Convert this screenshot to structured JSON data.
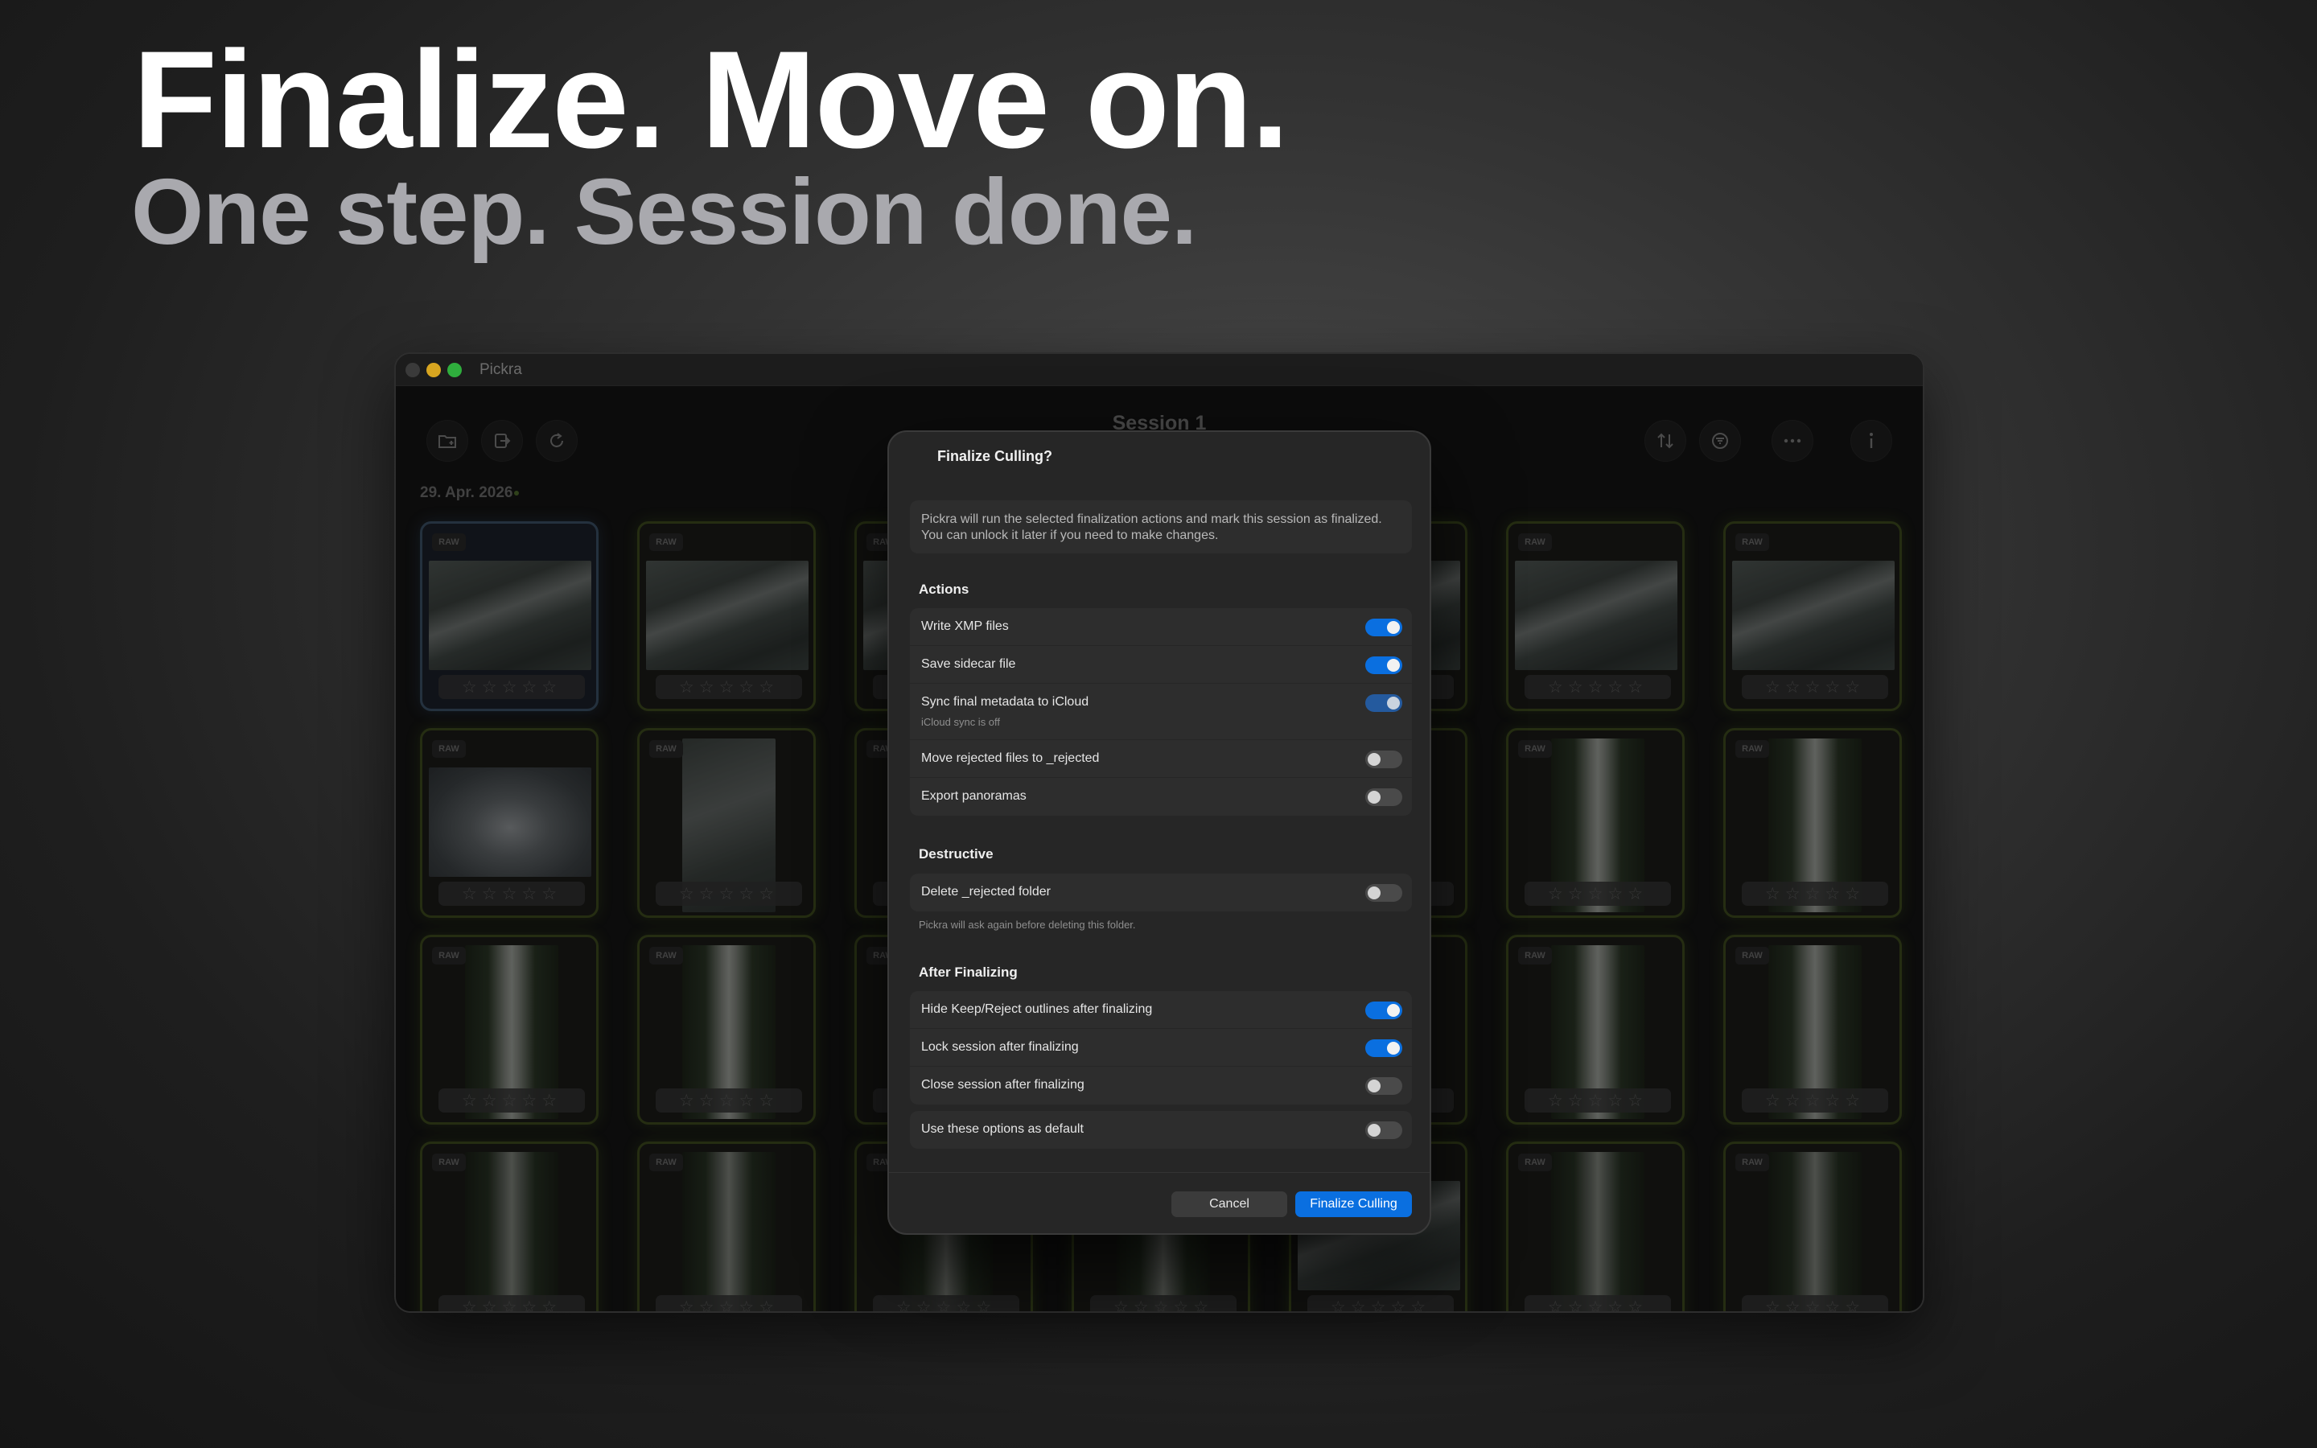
{
  "hero": {
    "title": "Finalize. Move on.",
    "subtitle": "One step. Session done."
  },
  "window": {
    "app_name": "Pickra",
    "session_title": "Session 1",
    "date_label": "29. Apr. 2026",
    "toolbar_icons": {
      "folder": "folder-add-icon",
      "export": "export-icon",
      "refresh": "refresh-icon",
      "sort": "sort-icon",
      "filter": "filter-icon",
      "more": "more-icon",
      "info": "info-icon"
    },
    "badge_text": "RAW",
    "rating_stars": "☆☆☆☆☆"
  },
  "dialog": {
    "title": "Finalize Culling?",
    "description": "Pickra will run the selected finalization actions and mark this session as finalized. You can unlock it later if you need to make changes.",
    "sections": {
      "actions": {
        "label": "Actions",
        "rows": [
          {
            "label": "Write XMP files",
            "on": true
          },
          {
            "label": "Save sidecar file",
            "on": true
          },
          {
            "label": "Sync final metadata to iCloud",
            "hint": "iCloud sync is off",
            "on": true
          },
          {
            "label": "Move rejected files to _rejected",
            "on": false
          },
          {
            "label": "Export panoramas",
            "on": false
          }
        ]
      },
      "destructive": {
        "label": "Destructive",
        "rows": [
          {
            "label": "Delete _rejected folder",
            "on": false
          }
        ],
        "note": "Pickra will ask again before deleting this folder."
      },
      "after": {
        "label": "After Finalizing",
        "rows": [
          {
            "label": "Hide Keep/Reject outlines after finalizing",
            "on": true
          },
          {
            "label": "Lock session after finalizing",
            "on": true
          },
          {
            "label": "Close session after finalizing",
            "on": false
          }
        ]
      },
      "default_row": {
        "label": "Use these options as default",
        "on": false
      }
    },
    "buttons": {
      "cancel": "Cancel",
      "confirm": "Finalize Culling"
    },
    "colors": {
      "accent": "#0a6fe0",
      "card_outline": "#3c4a1d"
    }
  }
}
